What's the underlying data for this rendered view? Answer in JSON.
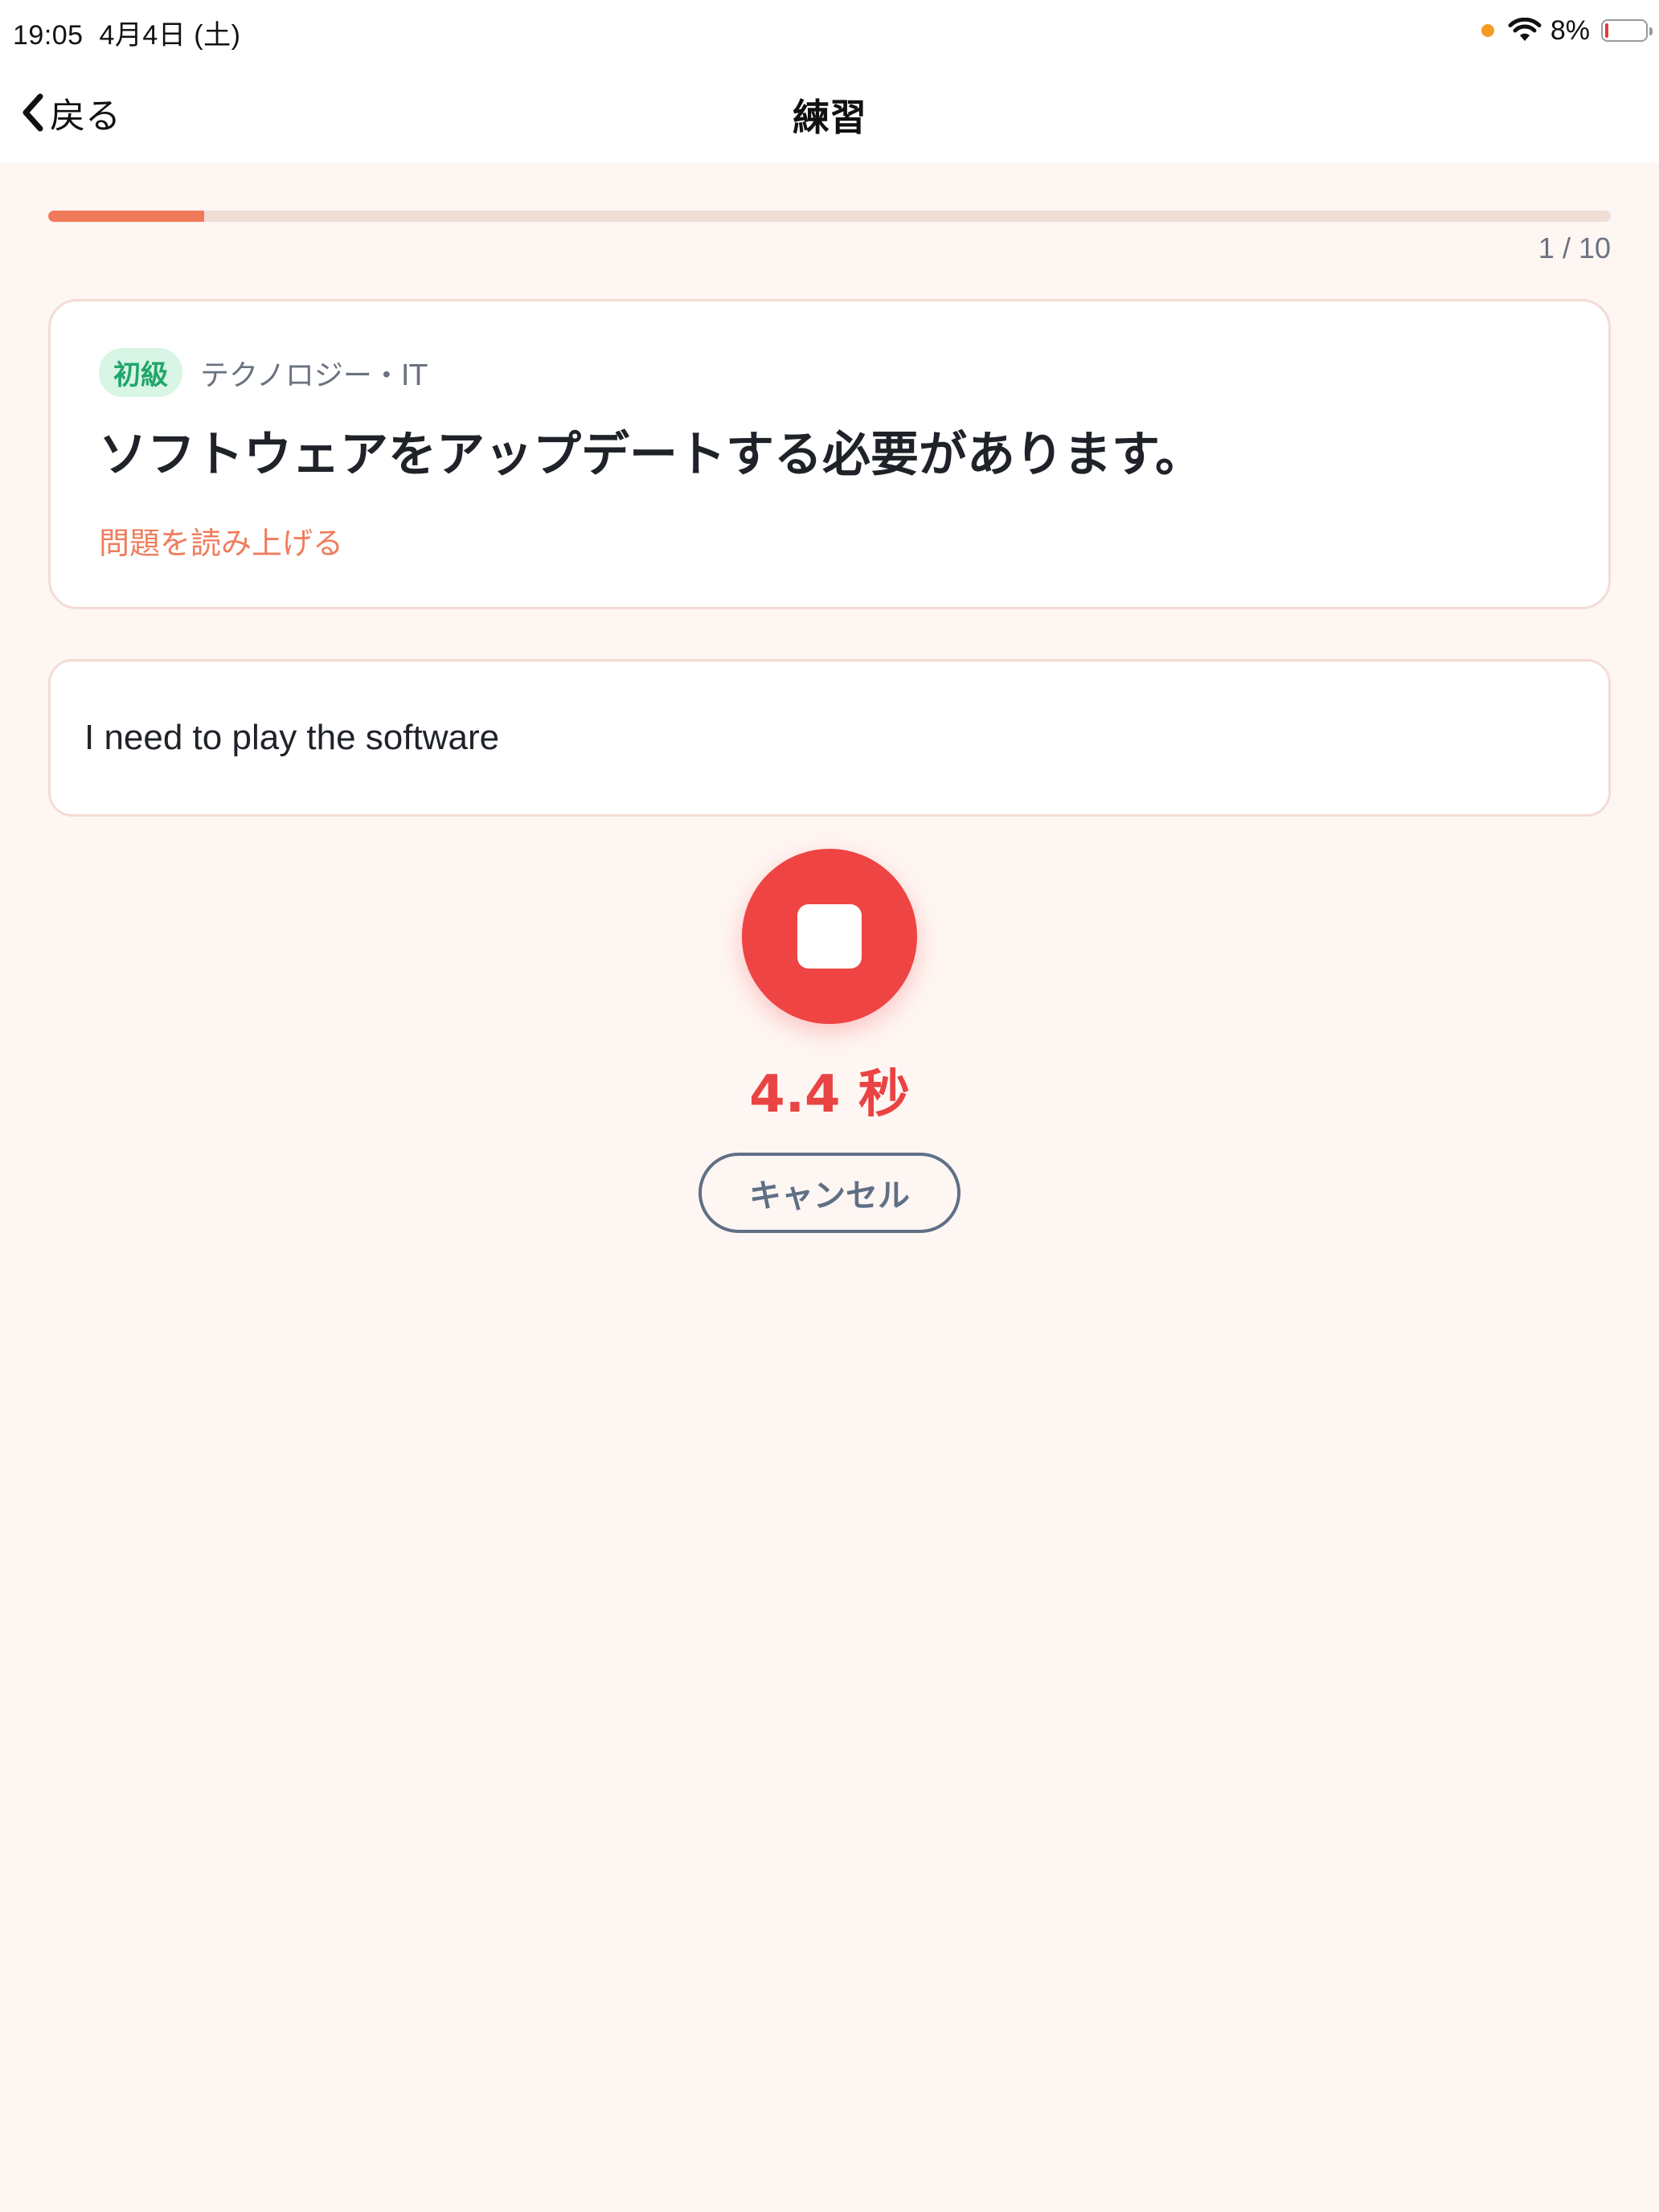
{
  "status_bar": {
    "time": "19:05",
    "date": "4月4日 (土)",
    "battery_percent": "8%",
    "battery_level": 0.08,
    "orange_dot_color": "#f59a23"
  },
  "nav": {
    "back_label": "戻る",
    "title": "練習"
  },
  "progress": {
    "current": 1,
    "total": 10,
    "label": "1 / 10",
    "fill_color": "#f0795a"
  },
  "question": {
    "level": "初級",
    "category": "テクノロジー・IT",
    "text": "ソフトウェアをアップデートする必要があります。",
    "read_aloud_label": "問題を読み上げる"
  },
  "answer": {
    "text": "I need to play the software"
  },
  "recording": {
    "timer": "4.4 秒",
    "accent_color": "#ef4444"
  },
  "actions": {
    "cancel_label": "キャンセル"
  },
  "icons": {
    "back": "chevron-left-icon",
    "wifi": "wifi-icon",
    "battery": "battery-icon",
    "stop": "stop-icon"
  }
}
